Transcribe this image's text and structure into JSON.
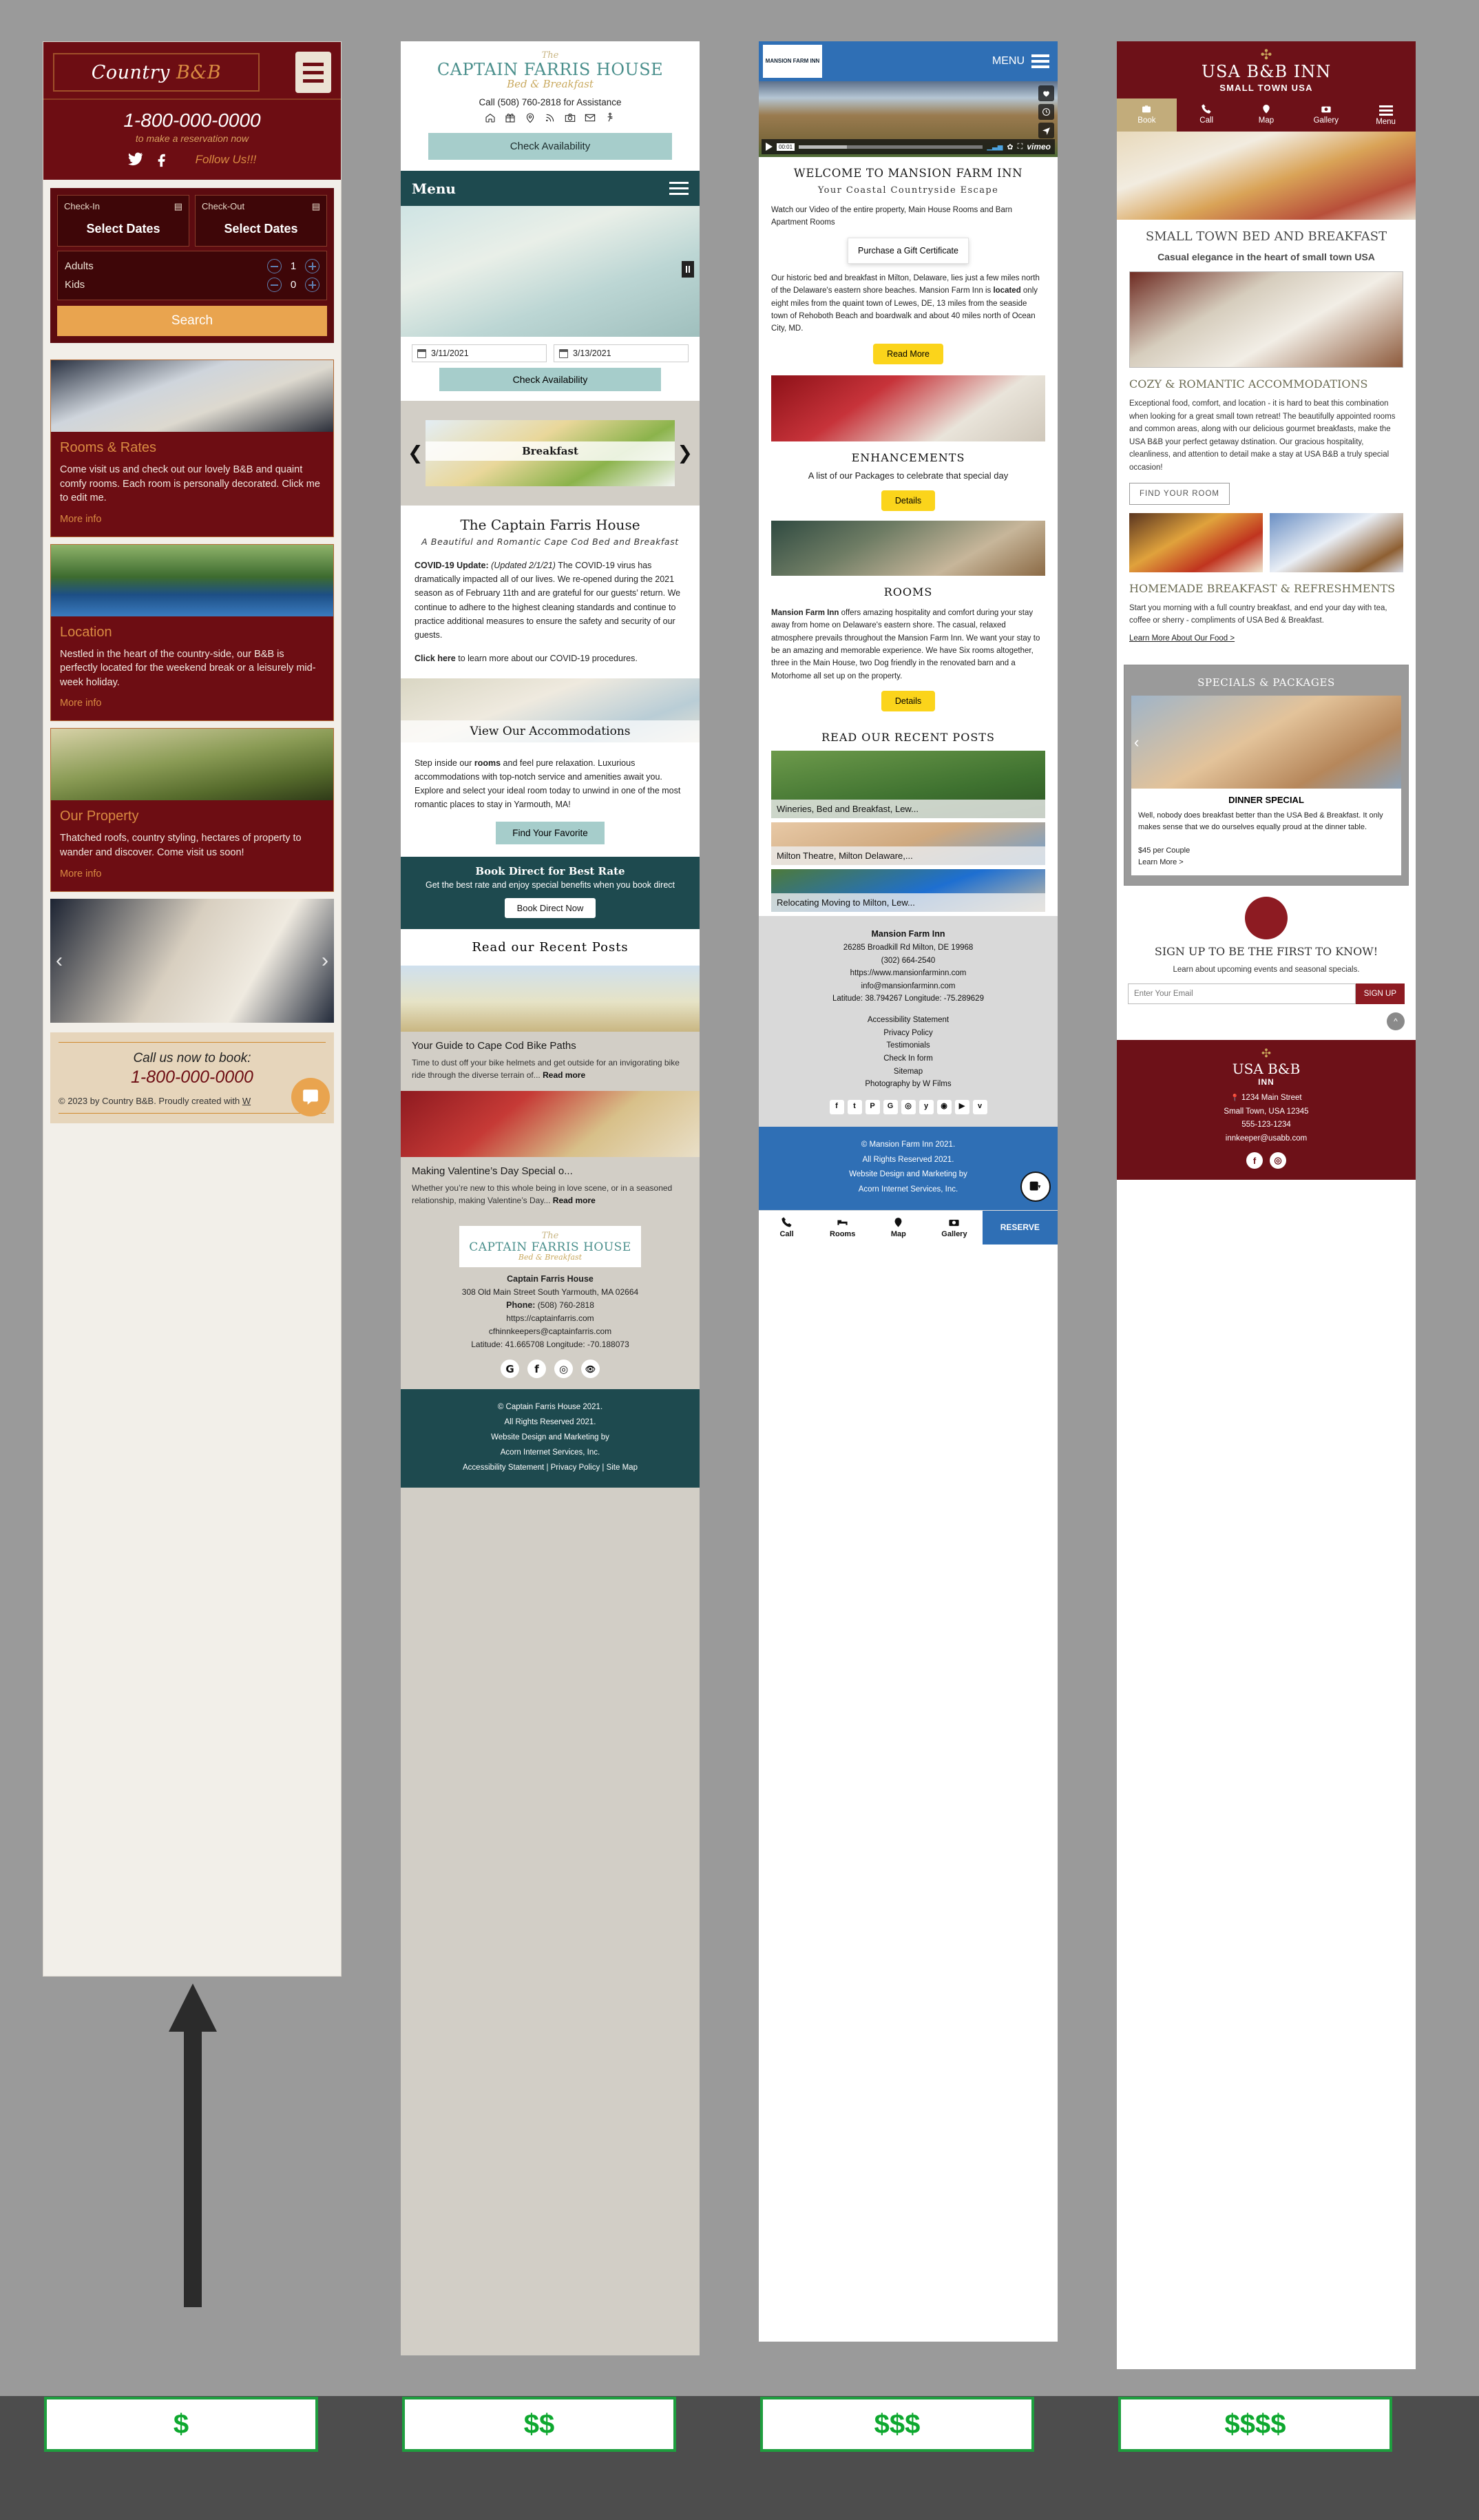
{
  "columns": [
    {
      "id": "country-bnb",
      "logo": {
        "word1": "Country",
        "word2": "B&B"
      },
      "phone": "1-800-000-0000",
      "phone_sub": "to make a reservation now",
      "follow": "Follow Us!!!",
      "booking": {
        "checkin_label": "Check-In",
        "checkin_value": "Select Dates",
        "checkout_label": "Check-Out",
        "checkout_value": "Select Dates",
        "adults_label": "Adults",
        "adults_value": "1",
        "kids_label": "Kids",
        "kids_value": "0",
        "search_label": "Search"
      },
      "cards": [
        {
          "title": "Rooms & Rates",
          "body": "Come visit us and check out our lovely B&B and quaint comfy rooms. Each room is personally decorated. Click me to edit me.",
          "more": "More info"
        },
        {
          "title": "Location",
          "body": "Nestled in the heart of the country-side, our B&B is perfectly located for the weekend break or a leisurely mid-week holiday.",
          "more": "More info"
        },
        {
          "title": "Our Property",
          "body": "Thatched roofs, country styling, hectares of property to wander and discover. Come visit us soon!",
          "more": "More info"
        }
      ],
      "footer": {
        "call": "Call us now to book:",
        "tel": "1-800-000-0000",
        "copy": "© 2023 by  Country B&B. Proudly created with ",
        "copy_link": "W"
      }
    },
    {
      "id": "captain-farris",
      "logo": {
        "the": "The",
        "name": "CAPTAIN FARRIS HOUSE",
        "sub": "Bed & Breakfast"
      },
      "call": "Call (508) 760-2818 for Assistance",
      "icons": [
        "home-icon",
        "gift-icon",
        "map-pin-icon",
        "rss-icon",
        "camera-icon",
        "mail-icon",
        "accessibility-icon"
      ],
      "check_availability": "Check Availability",
      "menu_label": "Menu",
      "dates": {
        "checkin": "3/11/2021",
        "checkout": "3/13/2021",
        "button": "Check Availability"
      },
      "carousel_caption": "Breakfast",
      "intro": {
        "title": "The Captain Farris House",
        "subtitle": "A Beautiful and Romantic Cape Cod Bed and Breakfast",
        "covid_label": "COVID-19 Update:",
        "covid_date": "(Updated 2/1/21)",
        "covid_body": " The COVID-19 virus has dramatically impacted all of our lives. We re-opened during the 2021 season as of February 11th and are grateful for our guests’ return.   We continue to adhere to the highest cleaning standards and continue to practice additional measures to ensure the safety and security of our guests.",
        "click_here": "Click here",
        "click_rest": " to learn more about our COVID-19 procedures."
      },
      "accommodations": {
        "caption": "View Our Accommodations",
        "body_pre": "Step inside our ",
        "body_bold": "rooms",
        "body_post": " and feel pure relaxation. Luxurious accommodations with top-notch service and amenities await you. Explore and select your ideal room today to unwind in one of the most romantic places to stay in Yarmouth, MA!",
        "button": "Find Your Favorite"
      },
      "book_direct": {
        "title": "Book Direct for Best Rate",
        "sub": "Get the best rate and enjoy special benefits when you book direct",
        "button": "Book Direct Now"
      },
      "posts_heading": "Read our Recent Posts",
      "posts": [
        {
          "title": "Your Guide to Cape Cod Bike Paths",
          "excerpt": "Time to dust off your bike helmets and get outside for an invigorating bike ride through the diverse terrain of... ",
          "more": "Read more"
        },
        {
          "title": "Making Valentine’s Day Special o...",
          "excerpt": "Whether you’re new to this whole being in love scene, or in a seasoned relationship, making Valentine’s Day... ",
          "more": "Read more"
        }
      ],
      "footer": {
        "name": "Captain Farris House",
        "address": "308 Old Main Street South Yarmouth, MA 02664",
        "phone_label": "Phone:",
        "phone": " (508) 760-2818",
        "url": "https://captainfarris.com",
        "email": "cfhinnkeepers@captainfarris.com",
        "coords": "Latitude: 41.665708 Longitude: -70.188073",
        "socials": [
          "google-icon",
          "facebook-icon",
          "instagram-icon",
          "tripadvisor-icon"
        ],
        "copy1": "© Captain Farris House 2021.",
        "copy2": "All Rights Reserved 2021.",
        "copy3": "Website Design and Marketing by",
        "copy4": "Acorn Internet Services, Inc.",
        "links": "Accessibility Statement | Privacy Policy | Site Map"
      }
    },
    {
      "id": "mansion-farm-inn",
      "logo_text": "MANSION FARM INN",
      "menu_label": "MENU",
      "video": {
        "time": "00:01",
        "brand": "vimeo"
      },
      "welcome_title": "WELCOME TO MANSION FARM INN",
      "welcome_sub": "Your Coastal Countryside Escape",
      "watch_text": "Watch our Video of the entire property, Main House Rooms and Barn Apartment Rooms",
      "gift_button": "Purchase a Gift Certificate",
      "about_pre": "Our historic bed and breakfast in Milton, Delaware, lies just a few miles north of the Delaware's eastern shore beaches. Mansion Farm Inn is ",
      "about_bold": "located",
      "about_post": " only eight miles from the quaint town of Lewes, DE, 13 miles from the seaside town of Rehoboth Beach and boardwalk and about 40 miles north of Ocean City, MD.",
      "read_more": "Read More",
      "enhancements": {
        "title": "ENHANCEMENTS",
        "sub": "A list of our Packages to celebrate that special day",
        "button": "Details"
      },
      "rooms": {
        "title": "ROOMS",
        "body_bold": "Mansion Farm Inn",
        "body": " offers amazing hospitality and comfort during your stay away from home on Delaware's eastern shore. The casual, relaxed atmosphere prevails throughout the Mansion Farm Inn. We want your stay to be an amazing and memorable experience. We have Six rooms altogether, three in the Main House, two Dog friendly in the renovated barn and a Motorhome all set up on the property.",
        "button": "Details"
      },
      "posts_heading": "READ OUR RECENT POSTS",
      "posts": [
        {
          "title": "Wineries, Bed and Breakfast, Lew..."
        },
        {
          "title": "Milton Theatre, Milton Delaware,..."
        },
        {
          "title": "Relocating Moving to Milton, Lew..."
        }
      ],
      "footer": {
        "name": "Mansion Farm Inn",
        "address": "26285 Broadkill Rd Milton, DE 19968",
        "phone": "(302) 664-2540",
        "url": "https://www.mansionfarminn.com",
        "email": "info@mansionfarminn.com",
        "coords": "Latitude: 38.794267 Longitude: -75.289629",
        "links": [
          "Accessibility Statement",
          "Privacy Policy",
          "Testimonials",
          "Check In form",
          "Sitemap",
          "Photography by W Films"
        ],
        "socials": [
          "facebook-icon",
          "twitter-icon",
          "pinterest-icon",
          "google-icon",
          "instagram-icon",
          "yelp-icon",
          "tripadvisor-icon",
          "youtube-icon",
          "vimeo-icon"
        ],
        "copy1": "© Mansion Farm Inn 2021.",
        "copy2": "All Rights Reserved 2021.",
        "copy3": "Website Design and Marketing by",
        "copy4": "Acorn Internet Services, Inc."
      },
      "tabs": [
        {
          "label": "Call",
          "icon": "phone-icon"
        },
        {
          "label": "Rooms",
          "icon": "bed-icon"
        },
        {
          "label": "Map",
          "icon": "map-pin-icon"
        },
        {
          "label": "Gallery",
          "icon": "camera-icon"
        },
        {
          "label": "RESERVE",
          "icon": "reserve"
        }
      ]
    },
    {
      "id": "usa-bnb-inn",
      "title": "USA B&B INN",
      "subtitle": "SMALL TOWN USA",
      "nav": [
        {
          "label": "Book",
          "icon": "briefcase-icon"
        },
        {
          "label": "Call",
          "icon": "phone-icon"
        },
        {
          "label": "Map",
          "icon": "map-pin-icon"
        },
        {
          "label": "Gallery",
          "icon": "camera-icon"
        },
        {
          "label": "Menu",
          "icon": "hamburger-icon"
        }
      ],
      "heading": "SMALL TOWN BED AND BREAKFAST",
      "subheading": "Casual elegance in the heart of small town USA",
      "cozy": {
        "title": "COZY & ROMANTIC ACCOMMODATIONS",
        "body": "Exceptional food, comfort, and location - it is hard to beat this combination when looking for a great small town retreat!  The beautifully appointed rooms and common areas, along with our delicious gourmet breakfasts, make the USA B&B your perfect getaway dstination.  Our gracious hospitality, cleanliness, and attention to detail make a stay at USA B&B a truly special occasion!",
        "button": "FIND YOUR ROOM"
      },
      "breakfast": {
        "title": "HOMEMADE BREAKFAST & REFRESHMENTS",
        "body": "Start you morning with a full country breakfast, and end your day with tea, coffee or sherry - compliments of USA Bed & Breakfast.",
        "link": "Learn More About Our Food >"
      },
      "specials": {
        "heading": "SPECIALS & PACKAGES",
        "title": "DINNER SPECIAL",
        "body": "Well, nobody does breakfast better than the USA Bed & Breakfast.  It only makes sense that we do ourselves equally proud at the dinner table.",
        "price": "$45 per Couple",
        "link": "Learn More >"
      },
      "signup": {
        "title": "SIGN UP TO BE THE FIRST TO KNOW!",
        "body": "Learn about upcoming events and seasonal specials.",
        "placeholder": "Enter Your Email",
        "button": "SIGN UP"
      },
      "footer": {
        "name": "USA B&B",
        "name2": "INN",
        "address1": "1234 Main Street",
        "address2": "Small Town, USA 12345",
        "phone": "555-123-1234",
        "email": "innkeeper@usabb.com",
        "socials": [
          "facebook-icon",
          "instagram-icon"
        ]
      }
    }
  ],
  "price_tiers": [
    "$",
    "$$",
    "$$$",
    "$$$$"
  ]
}
